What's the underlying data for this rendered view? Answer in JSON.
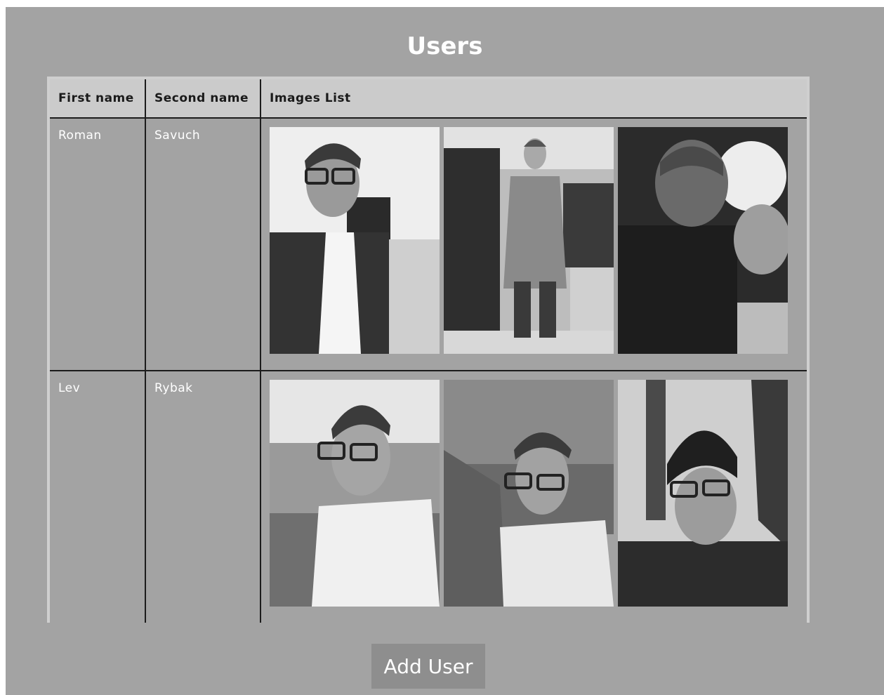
{
  "page": {
    "title": "Users",
    "add_button_label": "Add User"
  },
  "table": {
    "headers": [
      "First name",
      "Second name",
      "Images List"
    ],
    "rows": [
      {
        "first_name": "Roman",
        "second_name": "Savuch",
        "images": [
          "selfie-office-photo",
          "clothing-store-full-body-photo",
          "selfie-with-cat-photo"
        ]
      },
      {
        "first_name": "Lev",
        "second_name": "Rybak",
        "images": [
          "seaside-selfie-photo",
          "coastal-cliff-selfie-photo",
          "cap-selfie-photo"
        ]
      }
    ]
  },
  "colors": {
    "page_background": "#a3a3a3",
    "header_background": "#cbcbcb",
    "button_background": "#8e8e8e",
    "border": "#1c1c1c"
  }
}
